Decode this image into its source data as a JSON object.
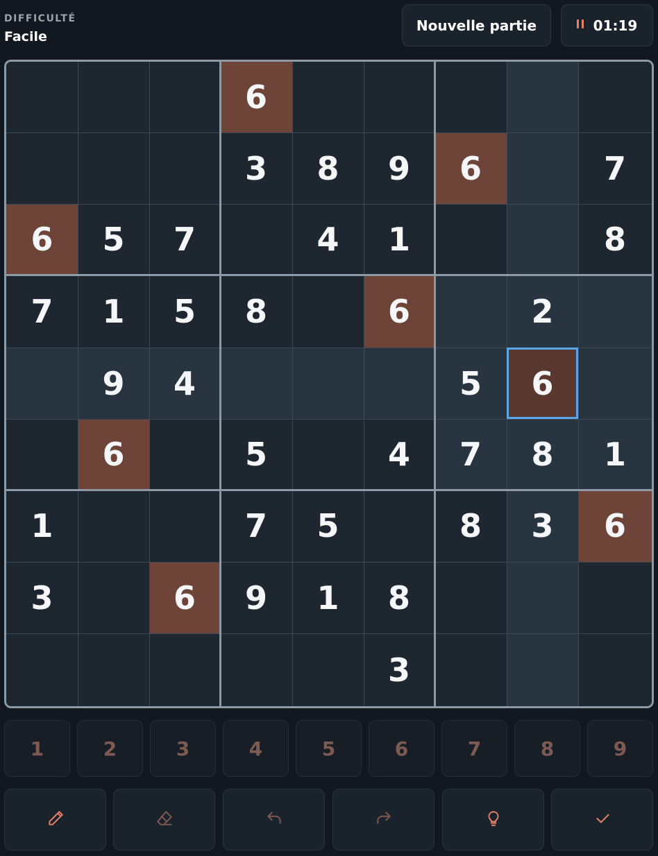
{
  "header": {
    "difficulty_label": "DIFFICULTÉ",
    "difficulty_value": "Facile",
    "new_game_label": "Nouvelle partie",
    "timer": "01:19"
  },
  "colors": {
    "background": "#111820",
    "cell": "#1e2730",
    "cell_highlight": "#28343f",
    "cell_same_number": "#6e4439",
    "cell_selected": "#5a3830",
    "selection_border": "#5aa6ea",
    "accent": "#e8816b"
  },
  "selected_cell": {
    "row": 5,
    "col": 8
  },
  "board": [
    [
      "",
      "",
      "",
      "6",
      "",
      "",
      "",
      "",
      ""
    ],
    [
      "",
      "",
      "",
      "3",
      "8",
      "9",
      "6",
      "",
      "7"
    ],
    [
      "6",
      "5",
      "7",
      "",
      "4",
      "1",
      "",
      "",
      "8"
    ],
    [
      "7",
      "1",
      "5",
      "8",
      "",
      "6",
      "",
      "2",
      ""
    ],
    [
      "",
      "9",
      "4",
      "",
      "",
      "",
      "5",
      "6",
      ""
    ],
    [
      "",
      "6",
      "",
      "5",
      "",
      "4",
      "7",
      "8",
      "1"
    ],
    [
      "1",
      "",
      "",
      "7",
      "5",
      "",
      "8",
      "3",
      "6"
    ],
    [
      "3",
      "",
      "6",
      "9",
      "1",
      "8",
      "",
      "",
      ""
    ],
    [
      "",
      "",
      "",
      "",
      "",
      "3",
      "",
      "",
      ""
    ]
  ],
  "numpad": [
    "1",
    "2",
    "3",
    "4",
    "5",
    "6",
    "7",
    "8",
    "9"
  ],
  "tools": [
    {
      "icon": "pencil-icon",
      "name": "pencil"
    },
    {
      "icon": "eraser-icon",
      "name": "eraser"
    },
    {
      "icon": "undo-icon",
      "name": "undo"
    },
    {
      "icon": "redo-icon",
      "name": "redo"
    },
    {
      "icon": "lightbulb-icon",
      "name": "hint"
    },
    {
      "icon": "check-icon",
      "name": "check"
    }
  ]
}
